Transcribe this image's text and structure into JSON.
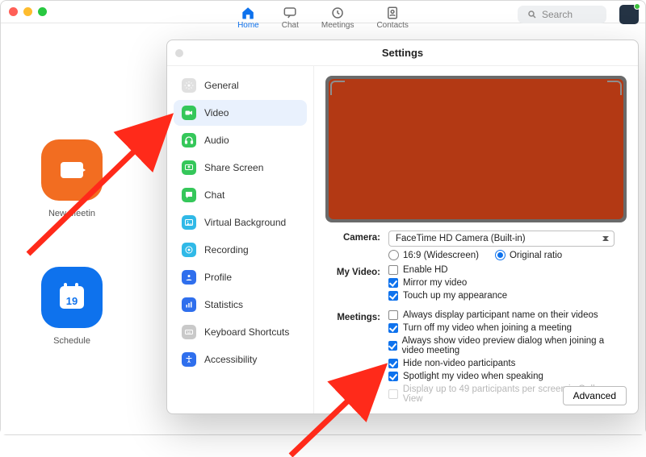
{
  "nav": {
    "tabs": [
      {
        "key": "home",
        "label": "Home"
      },
      {
        "key": "chat",
        "label": "Chat"
      },
      {
        "key": "meetings",
        "label": "Meetings"
      },
      {
        "key": "contacts",
        "label": "Contacts"
      }
    ],
    "active": "home",
    "search_placeholder": "Search"
  },
  "home": {
    "tiles": [
      {
        "key": "new-meeting",
        "label": "New Meetin",
        "color": "#f26d21"
      },
      {
        "key": "schedule",
        "label": "Schedule",
        "color": "#0e72ed",
        "cal_number": "19"
      }
    ]
  },
  "settings": {
    "title": "Settings",
    "sidebar": [
      {
        "key": "general",
        "label": "General",
        "icon": "gear-icon",
        "color": "#cfcfcf"
      },
      {
        "key": "video",
        "label": "Video",
        "icon": "video-icon",
        "color": "#35c75a"
      },
      {
        "key": "audio",
        "label": "Audio",
        "icon": "headphones-icon",
        "color": "#35c75a"
      },
      {
        "key": "share-screen",
        "label": "Share Screen",
        "icon": "share-icon",
        "color": "#35c75a"
      },
      {
        "key": "chat",
        "label": "Chat",
        "icon": "chat-icon",
        "color": "#35c75a"
      },
      {
        "key": "virtual-background",
        "label": "Virtual Background",
        "icon": "image-icon",
        "color": "#30b9e7"
      },
      {
        "key": "recording",
        "label": "Recording",
        "icon": "record-icon",
        "color": "#30b9e7"
      },
      {
        "key": "profile",
        "label": "Profile",
        "icon": "profile-icon",
        "color": "#2f6fed"
      },
      {
        "key": "statistics",
        "label": "Statistics",
        "icon": "stats-icon",
        "color": "#2f6fed"
      },
      {
        "key": "keyboard-shortcuts",
        "label": "Keyboard Shortcuts",
        "icon": "keyboard-icon",
        "color": "#9a9a9a"
      },
      {
        "key": "accessibility",
        "label": "Accessibility",
        "icon": "accessibility-icon",
        "color": "#2f6fed"
      }
    ],
    "active_section": "video",
    "video": {
      "camera_label": "Camera:",
      "camera_value": "FaceTime HD Camera (Built-in)",
      "aspect": {
        "options": [
          "16:9 (Widescreen)",
          "Original ratio"
        ],
        "selected": "Original ratio"
      },
      "my_video_label": "My Video:",
      "my_video": [
        {
          "key": "enable-hd",
          "label": "Enable HD",
          "checked": false
        },
        {
          "key": "mirror",
          "label": "Mirror my video",
          "checked": true
        },
        {
          "key": "touch-up",
          "label": "Touch up my appearance",
          "checked": true
        }
      ],
      "meetings_label": "Meetings:",
      "meetings": [
        {
          "key": "display-name",
          "label": "Always display participant name on their videos",
          "checked": false
        },
        {
          "key": "turn-off-join",
          "label": "Turn off my video when joining a meeting",
          "checked": true
        },
        {
          "key": "show-preview",
          "label": "Always show video preview dialog when joining a video meeting",
          "checked": true
        },
        {
          "key": "hide-nonvideo",
          "label": "Hide non-video participants",
          "checked": true
        },
        {
          "key": "spotlight",
          "label": "Spotlight my video when speaking",
          "checked": true
        },
        {
          "key": "display-49",
          "label": "Display up to 49 participants per screen in Gallery View",
          "checked": false,
          "disabled": true
        }
      ],
      "advanced_label": "Advanced"
    }
  }
}
